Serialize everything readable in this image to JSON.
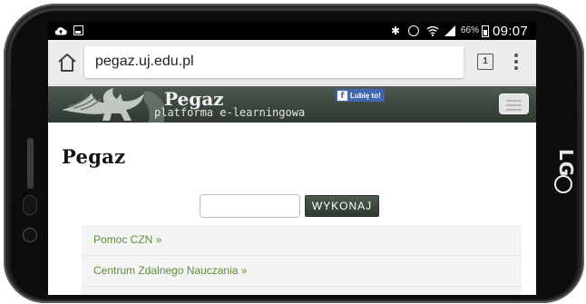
{
  "status_bar": {
    "battery_percent": "66%",
    "time": "09:07"
  },
  "browser": {
    "url": "pegaz.uj.edu.pl",
    "tab_count": "1"
  },
  "site_header": {
    "brand_name": "Pegaz",
    "brand_tagline": "platforma e-learningowa",
    "facebook_like_label": "Lubię to!"
  },
  "page": {
    "title": "Pegaz",
    "search": {
      "value": "",
      "placeholder": ""
    },
    "submit_label": "WYKONAJ",
    "links": [
      {
        "label": "Pomoc CZN »"
      },
      {
        "label": "Centrum Zdalnego Nauczania »"
      }
    ]
  },
  "device": {
    "brand": "LG"
  },
  "colors": {
    "header_green": "#3b473e",
    "link_green": "#5f8d3b",
    "facebook_blue": "#4267b2"
  }
}
